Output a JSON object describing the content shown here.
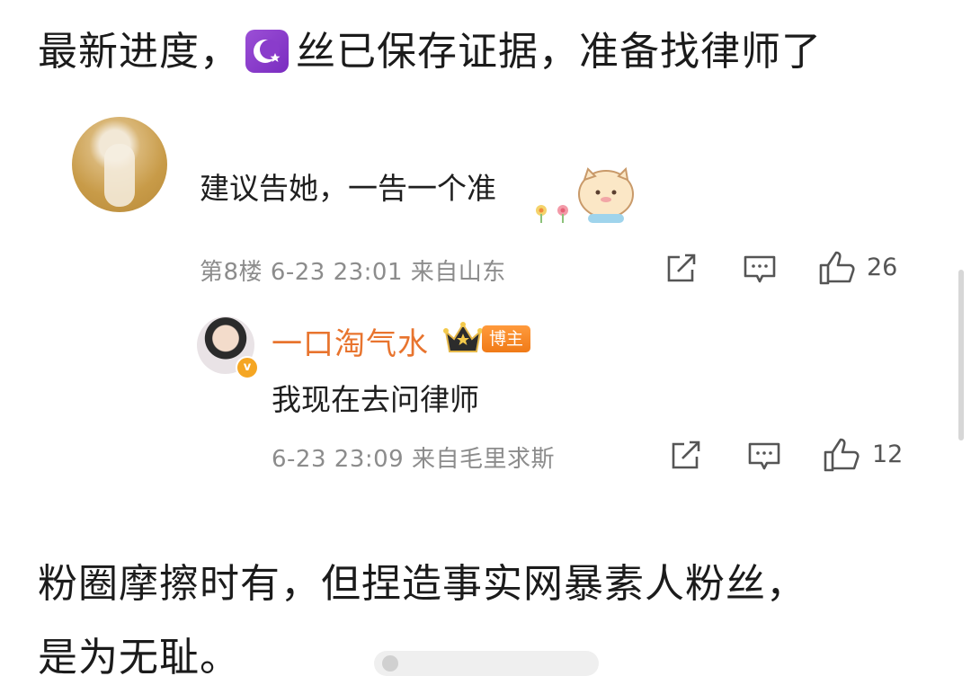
{
  "post": {
    "line1_before": "最新进度，",
    "line1_emoji": "moon-star-emoji",
    "line1_after": "丝已保存证据，准备找律师了",
    "line2": "粉圈摩擦时有，但捏造事实网暴素人粉丝，",
    "line3": "是为无耻。"
  },
  "comment1": {
    "text": "建议告她，一告一个准",
    "floor": "第8楼",
    "time": "6-23 23:01",
    "location": "来自山东",
    "like_count": "26"
  },
  "reply": {
    "name": "一口淘气水",
    "badge": "博主",
    "text": "我现在去问律师",
    "time": "6-23 23:09",
    "location": "来自毛里求斯",
    "like_count": "12"
  },
  "colors": {
    "name_orange": "#e8742e",
    "meta_gray": "#8c8c8c",
    "badge_orange": "#f07a17"
  }
}
